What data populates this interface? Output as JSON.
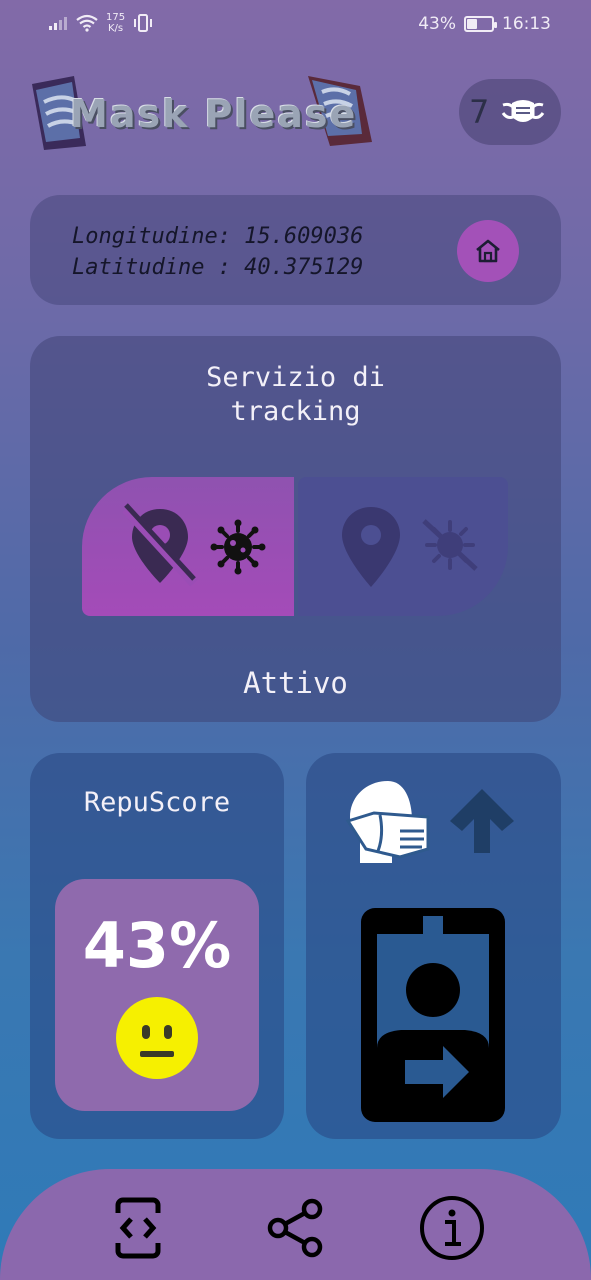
{
  "status_bar": {
    "network_speed_value": "175",
    "network_speed_unit": "K/s",
    "battery_percent_label": "43%",
    "battery_level": 0.43,
    "time": "16:13"
  },
  "header": {
    "logo_text": "Mask Please",
    "mask_count": "7"
  },
  "coordinates": {
    "longitude_line": "Longitudine: 15.609036",
    "latitude_line": "Latitudine : 40.375129"
  },
  "tracking": {
    "title_line1": "Servizio di",
    "title_line2": "tracking",
    "status": "Attivo",
    "active_side": "left"
  },
  "repuscore": {
    "title": "RepuScore",
    "value": "43%",
    "mood": "neutral"
  },
  "colors": {
    "accent_purple": "#a351b8",
    "toggle_active": "#9a4db5",
    "toggle_inactive": "#4c4f92",
    "smiley_yellow": "#f6f000",
    "nav_background": "#8b68ad"
  },
  "icons": {
    "home": "home-icon",
    "mask": "mask-icon",
    "location_off": "location-off-icon",
    "virus": "virus-icon",
    "location": "location-icon",
    "virus_off": "virus-off-icon",
    "masked_person": "masked-person-icon",
    "arrow_up": "arrow-up-icon",
    "badge_exit": "badge-exit-icon",
    "developer_mode": "developer-mode-icon",
    "share": "share-icon",
    "info": "info-icon"
  }
}
